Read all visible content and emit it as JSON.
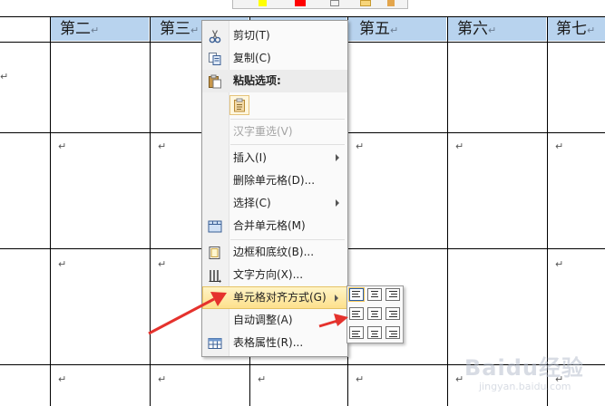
{
  "table": {
    "headers": [
      "第二",
      "第三",
      "",
      "第五",
      "第六",
      "第七"
    ],
    "cell_mark": "↵"
  },
  "context_menu": {
    "items": [
      {
        "label": "剪切(T)",
        "icon": "scissors-icon"
      },
      {
        "label": "复制(C)",
        "icon": "copy-icon"
      },
      {
        "label": "粘贴选项:",
        "icon": "paste-icon"
      },
      {
        "label": "汉字重选(V)",
        "disabled": true
      },
      {
        "label": "插入(I)",
        "submenu": true
      },
      {
        "label": "删除单元格(D)..."
      },
      {
        "label": "选择(C)",
        "submenu": true
      },
      {
        "label": "合并单元格(M)",
        "icon": "merge-cells-icon"
      },
      {
        "label": "边框和底纹(B)...",
        "icon": "borders-icon"
      },
      {
        "label": "文字方向(X)...",
        "icon": "text-direction-icon"
      },
      {
        "label": "单元格对齐方式(G)",
        "submenu": true,
        "highlighted": true
      },
      {
        "label": "自动调整(A)",
        "submenu": true
      },
      {
        "label": "表格属性(R)...",
        "icon": "table-properties-icon"
      }
    ]
  },
  "watermark": {
    "brand": "Baidu经验",
    "sub": "jingyan.baidu.com"
  },
  "colors": {
    "header_fill": "#b8d3ee",
    "highlight": "#fde08c",
    "arrow": "#e5322d"
  }
}
